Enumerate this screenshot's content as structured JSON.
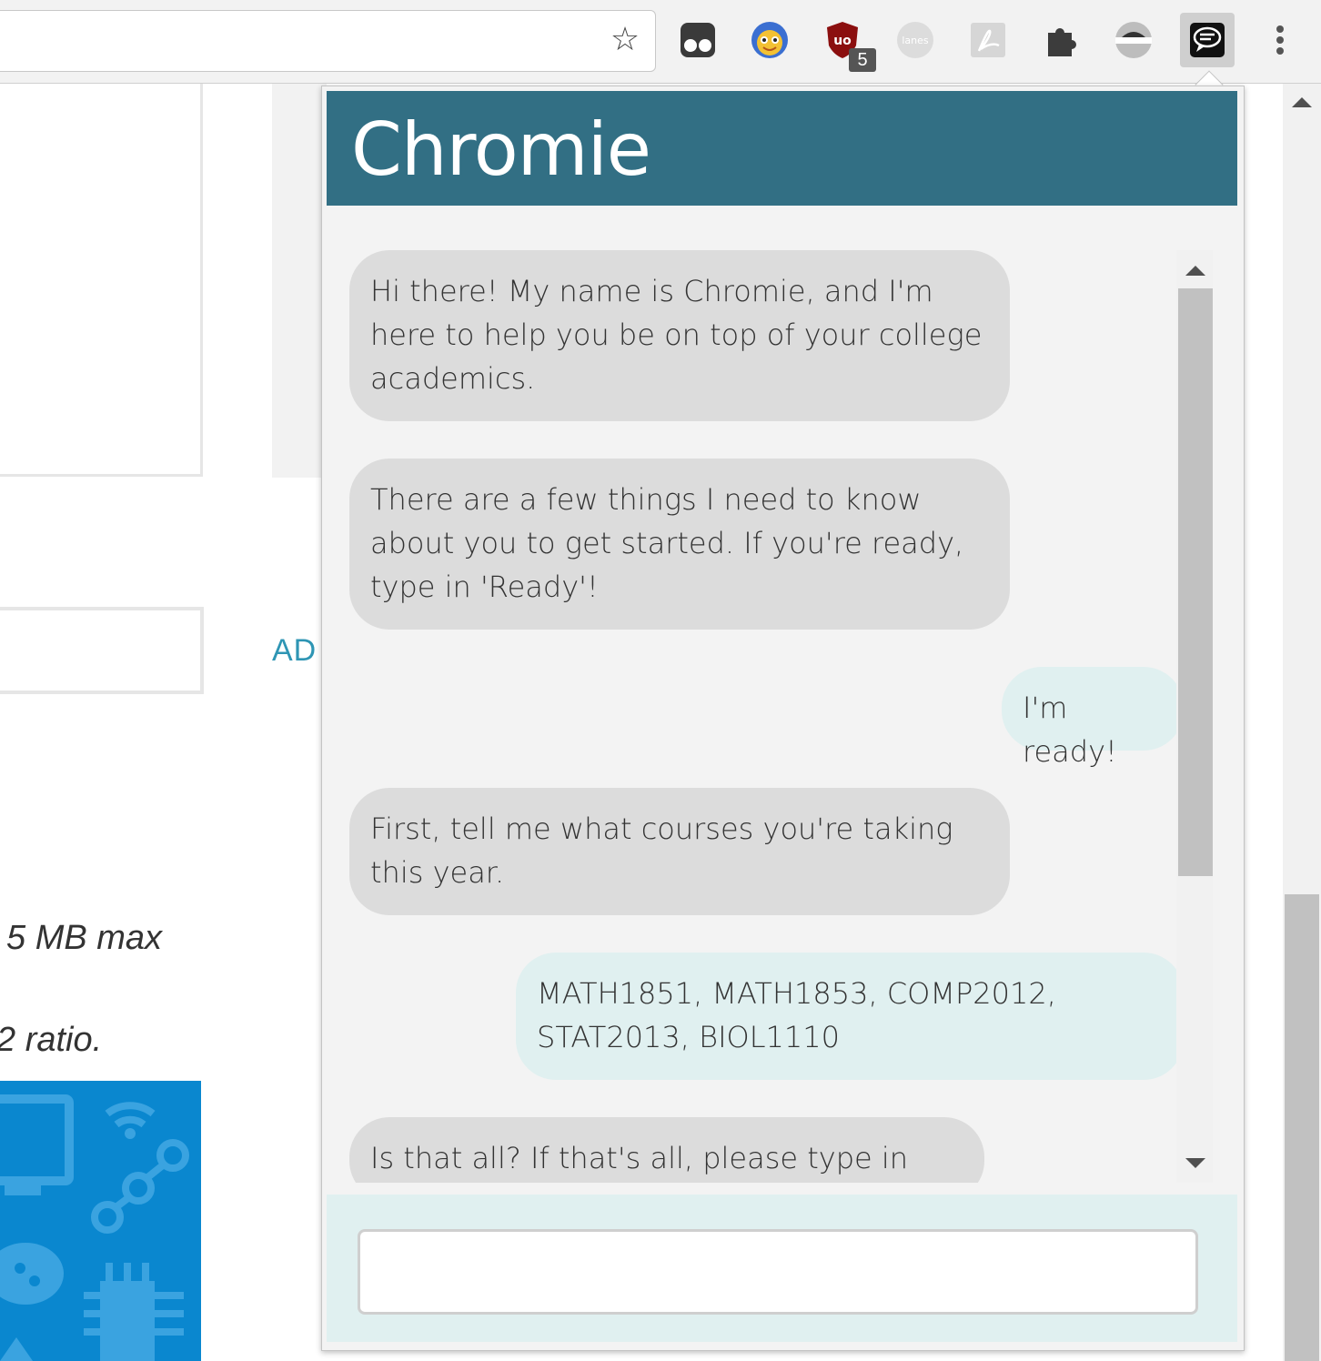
{
  "browser": {
    "extension_badge": "5",
    "extensions": [
      "tampermonkey-icon",
      "avatar-extension-icon",
      "ublock-origin-icon",
      "lanes-icon",
      "pdf-icon",
      "extensions-puzzle-icon",
      "ghostery-icon",
      "chat-bubble-icon"
    ],
    "lanes_label": "lanes"
  },
  "background_page": {
    "ad_label": "AD",
    "note_size": "5 MB max",
    "note_ratio": "2 ratio."
  },
  "chat": {
    "title": "Chromie",
    "header_color": "#326f84",
    "messages": [
      {
        "from": "bot",
        "text": "Hi there! My name is Chromie, and I'm here to help you be on top of your college academics."
      },
      {
        "from": "bot",
        "text": "There are a few things I need to know about you to get started. If you're ready, type in 'Ready'!"
      },
      {
        "from": "user",
        "text": "I'm ready!"
      },
      {
        "from": "bot",
        "text": "First, tell me what courses you're taking this year."
      },
      {
        "from": "user",
        "text": "MATH1851, MATH1853, COMP2012, STAT2013, BIOL1110"
      },
      {
        "from": "bot",
        "text": "Is that all? If that's all, please type in \\\"yes\\\"!"
      }
    ],
    "input_value": ""
  }
}
